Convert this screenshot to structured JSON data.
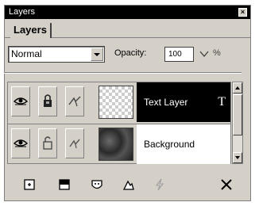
{
  "window": {
    "title": "Layers"
  },
  "tabs": [
    {
      "label": "Layers"
    }
  ],
  "controls": {
    "blend_mode": "Normal",
    "opacity_label": "Opacity:",
    "opacity_value": "100",
    "percent_sign": "%"
  },
  "layers": [
    {
      "name": "Text Layer",
      "type_glyph": "T",
      "selected": true,
      "thumbnail": "transparency-checkerboard"
    },
    {
      "name": "Background",
      "selected": false,
      "thumbnail": "dark-texture"
    }
  ],
  "toolbar": {
    "buttons": [
      "new-layer-icon",
      "new-adjustment-layer-icon",
      "mask-icon",
      "layer-style-icon",
      "effects-icon",
      "delete-icon"
    ]
  },
  "colors": {
    "selection": "#000000",
    "panel": "#d4d0c8"
  }
}
